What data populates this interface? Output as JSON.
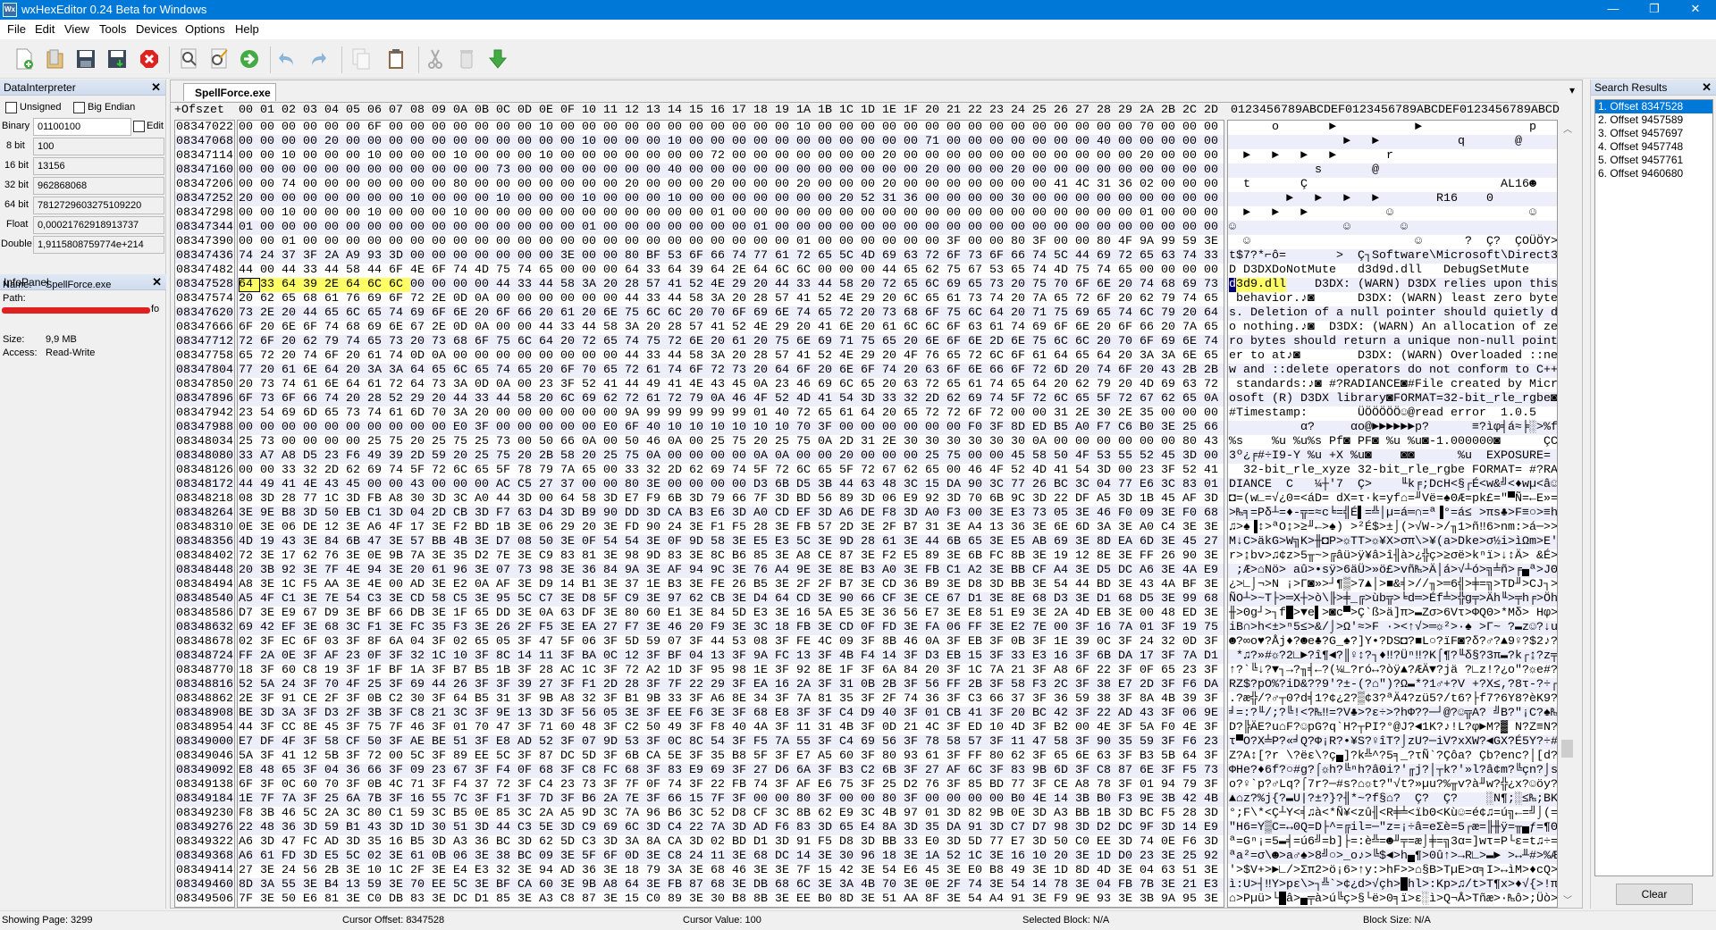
{
  "window": {
    "title": "wxHexEditor 0.24 Beta for Windows",
    "logo_text": "Wx",
    "minimize": "—",
    "restore": "❐",
    "close": "✕"
  },
  "menu": [
    "File",
    "Edit",
    "View",
    "Tools",
    "Devices",
    "Options",
    "Help"
  ],
  "toolbar": [
    "new-file-icon",
    "open-file-icon",
    "save-icon",
    "save-as-icon",
    "close-file-icon",
    "find-icon",
    "replace-icon",
    "goto-offset-icon",
    "undo-icon",
    "redo-icon",
    "copy-icon",
    "paste-icon",
    "cut-icon",
    "delete-icon",
    "insert-icon"
  ],
  "data_interpreter": {
    "title": "DataInterpreter",
    "unsigned_label": "Unsigned",
    "unsigned": false,
    "big_endian_label": "Big Endian",
    "big_endian": false,
    "edit_label": "Edit",
    "edit": false,
    "fields": [
      {
        "label": "Binary",
        "value": "01100100"
      },
      {
        "label": "8 bit",
        "value": "100"
      },
      {
        "label": "16 bit",
        "value": "13156"
      },
      {
        "label": "32 bit",
        "value": "962868068"
      },
      {
        "label": "64 bit",
        "value": "7812729603275109220"
      },
      {
        "label": "Float",
        "value": "0,00021762918913737"
      },
      {
        "label": "Double",
        "value": "1,9115808759774e+214"
      }
    ]
  },
  "info_panel": {
    "title": "InfoPanel",
    "name_label": "Name:",
    "name": "SpellForce.exe",
    "path_label": "Path:",
    "path_tail": "fo",
    "size_label": "Size:",
    "size": "9,9 MB",
    "access_label": "Access:",
    "access": "Read-Write"
  },
  "editor": {
    "tab": "SpellForce.exe",
    "tab_menu_icon": "▾",
    "offset_header": "+Ofszet",
    "column_headers": [
      "00",
      "01",
      "02",
      "03",
      "04",
      "05",
      "06",
      "07",
      "08",
      "09",
      "0A",
      "0B",
      "0C",
      "0D",
      "0E",
      "0F",
      "10",
      "11",
      "12",
      "13",
      "14",
      "15",
      "16",
      "17",
      "18",
      "19",
      "1A",
      "1B",
      "1C",
      "1D",
      "1E",
      "1F",
      "20",
      "21",
      "22",
      "23",
      "24",
      "25",
      "26",
      "27",
      "28",
      "29",
      "2A",
      "2B",
      "2C",
      "2D"
    ],
    "text_header": "0123456789ABCDEF0123456789ABCDEF0123456789ABCD",
    "cursor_row": "08347528",
    "cursor_byte": 0,
    "selection_length": 8,
    "colors": {
      "selection": "#ffff66",
      "cursor_text": "#000080",
      "row_alt": "#eeeefb"
    },
    "rows": [
      {
        "offset": "08347022",
        "hex": "00 00 00 00 00 00 6F 00 00 00 00 00 00 00 10 00 00 00 00 00 00 00 00 00 00 00 10 00 00 00 00 00 00 00 00 00 00 00 00 00 00 00 70 00 00 00"
      },
      {
        "offset": "08347068",
        "hex": "00 00 00 00 20 00 00 00 00 00 00 00 00 00 00 00 10 00 00 00 10 00 00 00 00 00 00 00 00 00 00 00 71 00 00 00 00 00 00 00 40 00 00 00 00 00"
      },
      {
        "offset": "08347114",
        "hex": "00 00 10 00 00 00 10 00 00 00 10 00 00 00 10 00 00 00 00 00 00 00 72 00 00 00 00 00 00 00 20 00 00 00 00 00 00 00 00 00 00 00 20 00 00 00"
      },
      {
        "offset": "08347160",
        "hex": "00 00 00 00 00 00 00 00 00 00 00 00 73 00 00 00 00 00 00 00 40 00 00 00 00 00 00 00 00 00 00 00 20 00 00 00 20 00 00 00 00 00 00 00 00 00"
      },
      {
        "offset": "08347206",
        "hex": "00 00 74 00 00 00 00 00 00 00 80 00 00 00 00 00 00 00 20 00 00 00 20 00 00 00 20 00 00 00 20 00 00 00 00 00 00 00 41 4C 31 36 02 00 00 00"
      },
      {
        "offset": "08347252",
        "hex": "20 00 00 00 00 00 00 00 10 00 00 00 10 00 00 00 10 00 00 00 10 00 00 00 00 00 00 00 20 52 31 36 00 00 00 00 30 00 00 00 00 00 00 00 00 00"
      },
      {
        "offset": "08347298",
        "hex": "00 00 10 00 00 00 10 00 00 00 10 00 00 00 00 00 00 00 00 00 00 00 01 00 00 00 00 00 00 00 00 00 00 00 00 00 00 00 00 00 00 00 01 00 00 00"
      },
      {
        "offset": "08347344",
        "hex": "01 00 00 00 00 00 00 00 00 00 00 00 00 00 00 00 01 00 00 00 00 00 00 00 01 00 00 00 00 00 00 00 00 00 00 00 00 00 00 00 00 00 00 00 00 00"
      },
      {
        "offset": "08347390",
        "hex": "00 00 01 00 00 00 00 00 00 00 00 00 00 00 00 00 00 00 00 00 00 00 00 00 00 00 01 00 00 00 00 00 00 3F 00 00 80 3F 00 00 80 4F 9A 99 59 3E"
      },
      {
        "offset": "08347436",
        "hex": "74 24 37 3F 2A A9 93 3D 00 00 00 00 00 00 00 3E 00 00 80 BF 53 6F 66 74 77 61 72 65 5C 4D 69 63 72 6F 73 6F 66 74 5C 44 69 72 65 63 74 33"
      },
      {
        "offset": "08347482",
        "hex": "44 00 44 33 44 58 44 6F 4E 6F 74 4D 75 74 65 00 00 00 64 33 64 39 64 2E 64 6C 6C 00 00 00 44 65 62 75 67 53 65 74 4D 75 74 65 00 00 00 00"
      },
      {
        "offset": "08347528",
        "hex": "64 33 64 39 2E 64 6C 6C 00 00 00 00 44 33 44 58 3A 20 28 57 41 52 4E 29 20 44 33 44 58 20 72 65 6C 69 65 73 20 75 70 6F 6E 20 74 68 69 73"
      },
      {
        "offset": "08347574",
        "hex": "20 62 65 68 61 76 69 6F 72 2E 0D 0A 00 00 00 00 00 00 44 33 44 58 3A 20 28 57 41 52 4E 29 20 6C 65 61 73 74 20 7A 65 72 6F 20 62 79 74 65"
      },
      {
        "offset": "08347620",
        "hex": "73 2E 20 44 65 6C 65 74 69 6F 6E 20 6F 66 20 61 20 6E 75 6C 6C 20 70 6F 69 6E 74 65 72 20 73 68 6F 75 6C 64 20 71 75 69 65 74 6C 79 20 64"
      },
      {
        "offset": "08347666",
        "hex": "6F 20 6E 6F 74 68 69 6E 67 2E 0D 0A 00 00 44 33 44 58 3A 20 28 57 41 52 4E 29 20 41 6E 20 61 6C 6C 6F 63 61 74 69 6F 6E 20 6F 66 20 7A 65"
      },
      {
        "offset": "08347712",
        "hex": "72 6F 20 62 79 74 65 73 20 73 68 6F 75 6C 64 20 72 65 74 75 72 6E 20 61 20 75 6E 69 71 75 65 20 6E 6F 6E 2D 6E 75 6C 6C 20 70 6F 69 6E 74"
      },
      {
        "offset": "08347758",
        "hex": "65 72 20 74 6F 20 61 74 0D 0A 00 00 00 00 00 00 00 00 44 33 44 58 3A 20 28 57 41 52 4E 29 20 4F 76 65 72 6C 6F 61 64 65 64 20 3A 3A 6E 65"
      },
      {
        "offset": "08347804",
        "hex": "77 20 61 6E 64 20 3A 3A 64 65 6C 65 74 65 20 6F 70 65 72 61 74 6F 72 73 20 64 6F 20 6E 6F 74 20 63 6F 6E 66 6F 72 6D 20 74 6F 20 43 2B 2B"
      },
      {
        "offset": "08347850",
        "hex": "20 73 74 61 6E 64 61 72 64 73 3A 0D 0A 00 23 3F 52 41 44 49 41 4E 43 45 0A 23 46 69 6C 65 20 63 72 65 61 74 65 64 20 62 79 20 4D 69 63 72"
      },
      {
        "offset": "08347896",
        "hex": "6F 73 6F 66 74 20 28 52 29 20 44 33 44 58 20 6C 69 62 72 61 72 79 0A 46 4F 52 4D 41 54 3D 33 32 2D 62 69 74 5F 72 6C 65 5F 72 67 62 65 0A"
      },
      {
        "offset": "08347942",
        "hex": "23 54 69 6D 65 73 74 61 6D 70 3A 20 00 00 00 00 00 00 9A 99 99 99 99 99 01 40 72 65 61 64 20 65 72 72 6F 72 00 00 31 2E 30 2E 35 00 00 00"
      },
      {
        "offset": "08347988",
        "hex": "00 00 00 00 00 00 00 00 00 00 E0 3F 00 00 00 00 00 E0 6F 40 10 10 10 10 10 10 70 3F 00 00 00 00 00 00 F0 3F 8D ED B5 A0 F7 C6 B0 3E 25 66"
      },
      {
        "offset": "08348034",
        "hex": "25 73 00 00 00 00 25 75 20 25 75 25 73 00 50 66 0A 00 50 46 0A 00 25 75 20 25 75 0A 2D 31 2E 30 30 30 30 30 30 0A 00 00 00 00 00 00 80 43"
      },
      {
        "offset": "08348080",
        "hex": "33 A7 A8 D5 23 F6 49 39 2D 59 20 25 75 20 2B 58 20 25 75 0A 00 00 00 00 0A 0A 00 00 20 00 00 00 25 75 00 00 45 58 50 4F 53 55 52 45 3D 00"
      },
      {
        "offset": "08348126",
        "hex": "00 00 33 32 2D 62 69 74 5F 72 6C 65 5F 78 79 7A 65 00 33 32 2D 62 69 74 5F 72 6C 65 5F 72 67 62 65 00 46 4F 52 4D 41 54 3D 00 23 3F 52 41"
      },
      {
        "offset": "08348172",
        "hex": "44 49 41 4E 43 45 00 00 43 00 00 00 AC C5 27 37 00 00 80 3E 00 00 00 00 D3 6B D5 3B 44 63 48 3C 15 DA 90 3C 77 26 BC 3C 04 77 E6 3C 83 01"
      },
      {
        "offset": "08348218",
        "hex": "08 3D 28 77 1C 3D FB A8 30 3D 3C A0 44 3D 00 64 58 3D E7 F9 6B 3D 79 66 7F 3D BD 56 89 3D 06 E9 92 3D 70 6B 9C 3D 22 DF A5 3D 1B 45 AF 3D"
      },
      {
        "offset": "08348264",
        "hex": "3E 9E B8 3D 50 EB C1 3D 04 2D CB 3D F7 63 D4 3D B9 90 DD 3D CA B3 E6 3D A0 CD EF 3D A6 DE F8 3D A0 F3 00 3E E3 73 05 3E 46 F0 09 3E F0 68"
      },
      {
        "offset": "08348310",
        "hex": "0E 3E 06 DE 12 3E A6 4F 17 3E F2 BD 1B 3E 06 29 20 3E FD 90 24 3E F1 F5 28 3E FB 57 2D 3E 2F B7 31 3E A4 13 36 3E 6E 6D 3A 3E A0 C4 3E 3E"
      },
      {
        "offset": "08348356",
        "hex": "4D 19 43 3E 84 6B 47 3E 57 BB 4B 3E D7 08 50 3E 0F 54 54 3E 0F 9D 58 3E E5 E3 5C 3E 9D 28 61 3E 44 6B 65 3E E5 AB 69 3E 8D EA 6D 3E 45 27"
      },
      {
        "offset": "08348402",
        "hex": "72 3E 17 62 76 3E 0E 9B 7A 3E 35 D2 7E 3E C9 83 81 3E 98 9D 83 3E 8C B6 85 3E A8 CE 87 3E F2 E5 89 3E 6B FC 8B 3E 19 12 8E 3E FF 26 90 3E"
      },
      {
        "offset": "08348448",
        "hex": "20 3B 92 3E 7F 4E 94 3E 20 61 96 3E 07 73 98 3E 36 84 9A 3E AF 94 9C 3E 76 A4 9E 3E 8E B3 A0 3E FB C1 A2 3E BB CF A4 3E D5 DC A6 3E 4A E9"
      },
      {
        "offset": "08348494",
        "hex": "A8 3E 1C F5 AA 3E 4E 00 AD 3E E2 0A AF 3E D9 14 B1 3E 37 1E B3 3E FE 26 B5 3E 2F 2F B7 3E CD 36 B9 3E D8 3D BB 3E 54 44 BD 3E 43 4A BF 3E"
      },
      {
        "offset": "08348540",
        "hex": "A5 4F C1 3E 7E 54 C3 3E CD 58 C5 3E 95 5C C7 3E D8 5F C9 3E 97 62 CB 3E D4 64 CD 3E 90 66 CF 3E CE 67 D1 3E 8E 68 D3 3E D1 68 D5 3E 99 68"
      },
      {
        "offset": "08348586",
        "hex": "D7 3E E9 67 D9 3E BF 66 DB 3E 1F 65 DD 3E 0A 63 DF 3E 80 60 E1 3E 84 5D E3 3E 16 5A E5 3E 36 56 E7 3E E8 51 E9 3E 2A 4D EB 3E 00 48 ED 3E"
      },
      {
        "offset": "08348632",
        "hex": "69 42 EF 3E 68 3C F1 3E FC 35 F3 3E 26 2F F5 3E EA 27 F7 3E 46 20 F9 3E 3C 18 FB 3E CD 0F FD 3E FA 06 FF 3E E2 7E 00 3F 16 7A 01 3F 19 75"
      },
      {
        "offset": "08348678",
        "hex": "02 3F EC 6F 03 3F 8F 6A 04 3F 02 65 05 3F 47 5F 06 3F 5D 59 07 3F 44 53 08 3F FE 4C 09 3F 8B 46 0A 3F EB 3F 0B 3F 1E 39 0C 3F 24 32 0D 3F"
      },
      {
        "offset": "08348724",
        "hex": "FF 2A 0E 3F AF 23 0F 3F 32 1C 10 3F 8C 14 11 3F BA 0C 12 3F BF 04 13 3F 9A FC 13 3F 4B F4 14 3F D3 EB 15 3F 33 E3 16 3F 6B DA 17 3F 7A D1"
      },
      {
        "offset": "08348770",
        "hex": "18 3F 60 C8 19 3F 1F BF 1A 3F B7 B5 1B 3F 28 AC 1C 3F 72 A2 1D 3F 95 98 1E 3F 92 8E 1F 3F 6A 84 20 3F 1C 7A 21 3F A8 6F 22 3F 0F 65 23 3F"
      },
      {
        "offset": "08348816",
        "hex": "52 5A 24 3F 70 4F 25 3F 69 44 26 3F 3F 39 27 3F F1 2D 28 3F 7F 22 29 3F EA 16 2A 3F 31 0B 2B 3F 56 FF 2B 3F 58 F3 2C 3F 38 E7 2D 3F F6 DA"
      },
      {
        "offset": "08348862",
        "hex": "2E 3F 91 CE 2F 3F 0B C2 30 3F 64 B5 31 3F 9B A8 32 3F B1 9B 33 3F A6 8E 34 3F 7A 81 35 3F 2F 74 36 3F C3 66 37 3F 36 59 38 3F 8A 4B 39 3F"
      },
      {
        "offset": "08348908",
        "hex": "BE 3D 3A 3F D3 2F 3B 3F C8 21 3C 3F 9E 13 3D 3F 56 05 3E 3F EE F6 3E 3F 68 E8 3F 3F C4 D9 40 3F 01 CB 41 3F 20 BC 42 3F 22 AD 43 3F 06 9E"
      },
      {
        "offset": "08348954",
        "hex": "44 3F CC 8E 45 3F 75 7F 46 3F 01 70 47 3F 71 60 48 3F C2 50 49 3F F8 40 4A 3F 11 31 4B 3F 0D 21 4C 3F ED 10 4D 3F B2 00 4E 3F 5A F0 4E 3F"
      },
      {
        "offset": "08349000",
        "hex": "E7 DF 4F 3F 58 CF 50 3F AE BE 51 3F E8 AD 52 3F 07 9D 53 3F 0C 8C 54 3F F5 7A 55 3F C4 69 56 3F 78 58 57 3F 11 47 58 3F 90 35 59 3F F6 23"
      },
      {
        "offset": "08349046",
        "hex": "5A 3F 41 12 5B 3F 72 00 5C 3F 89 EE 5C 3F 87 DC 5D 3F 6B CA 5E 3F 35 B8 5F 3F E7 A5 60 3F 80 93 61 3F FF 80 62 3F 65 6E 63 3F B3 5B 64 3F"
      },
      {
        "offset": "08349092",
        "hex": "E8 48 65 3F 04 36 66 3F 09 23 67 3F F4 0F 68 3F C8 FC 68 3F 83 E9 69 3F 27 D6 6A 3F B3 C2 6B 3F 27 AF 6C 3F 83 9B 6D 3F C8 87 6E 3F F5 73"
      },
      {
        "offset": "08349138",
        "hex": "6F 3F 0C 60 70 3F 0B 4C 71 3F F4 37 72 3F C4 23 73 3F 7F 0F 74 3F 22 FB 74 3F AF E6 75 3F 25 D2 76 3F 85 BD 77 3F CE A8 78 3F 01 94 79 3F"
      },
      {
        "offset": "08349184",
        "hex": "1E 7F 7A 3F 25 6A 7B 3F 16 55 7C 3F F1 3F 7D 3F B6 2A 7E 3F 66 15 7F 3F 00 00 80 3F 00 00 80 3F 00 00 00 00 B0 4E 14 3B B0 F3 9E 3B 42 4B"
      },
      {
        "offset": "08349230",
        "hex": "F8 3B 46 5C 2A 3C 80 C1 59 3C B5 0E 85 3C 2A A5 9D 3C 7A 96 B6 3C 52 D8 CF 3C 8B 62 E9 3C 4B 97 01 3D 82 9B 0E 3D A3 BB 1B 3D BC F5 28 3D"
      },
      {
        "offset": "08349276",
        "hex": "22 48 36 3D 59 B1 43 3D 1D 30 51 3D 44 C3 5E 3D C9 69 6C 3D C4 22 7A 3D AD F6 83 3D 65 E4 8A 3D 35 DA 91 3D C7 D7 98 3D D2 DC 9F 3D 14 E9"
      },
      {
        "offset": "08349322",
        "hex": "A6 3D 47 FC AD 3D 35 16 B5 3D A3 36 BC 3D 62 5D C3 3D 3A 8A CA 3D 02 BD D1 3D 91 F5 D8 3D BB 33 E0 3D 5D 77 E7 3D 50 C0 EE 3D 74 0E F6 3D"
      },
      {
        "offset": "08349368",
        "hex": "A6 61 FD 3D E5 5C 02 3E 61 0B 06 3E 38 BC 09 3E 5F 6F 0D 3E C8 24 11 3E 68 DC 14 3E 30 96 18 3E 1A 52 1C 3E 16 10 20 3E 1D D0 23 3E 25 92"
      },
      {
        "offset": "08349414",
        "hex": "27 3E 24 56 2B 3E 10 1C 2F 3E E4 E3 32 3E 94 AD 36 3E 18 79 3A 3E 68 46 3E 3E 7F 15 42 3E 54 E6 45 3E E0 B8 49 3E 1D 8D 4D 3E 04 63 51 3E"
      },
      {
        "offset": "08349460",
        "hex": "8D 3A 55 3E B4 13 59 3E 70 EE 5C 3E BF CA 60 3E 9B A8 64 3E FB 87 68 3E DB 68 6C 3E 3A 4B 70 3E 0E 2F 74 3E 54 14 78 3E 04 FB 7B 3E 21 E3"
      },
      {
        "offset": "08349506",
        "hex": "7F 3E 50 E6 81 3E C0 DB 83 3E DC D1 85 3E A3 C8 87 3E 15 C0 89 3E 30 B8 8B 3E EE B0 8D 3E 51 AA 8F 3E 54 A4 91 3E F9 9E 93 3E 3B 9A 95 3E"
      }
    ]
  },
  "search_results": {
    "title": "Search Results",
    "items": [
      "1. Offset 8347528",
      "2. Offset 9457589",
      "3. Offset 9457697",
      "4. Offset 9457748",
      "5. Offset 9457761",
      "6. Offset 9460680"
    ],
    "selected_index": 0,
    "clear_label": "Clear"
  },
  "status": {
    "page": "Showing Page: 3299",
    "cursor_offset": "Cursor Offset: 8347528",
    "cursor_value": "Cursor Value: 100",
    "selected_block": "Selected Block: N/A",
    "block_size": "Block Size: N/A"
  }
}
